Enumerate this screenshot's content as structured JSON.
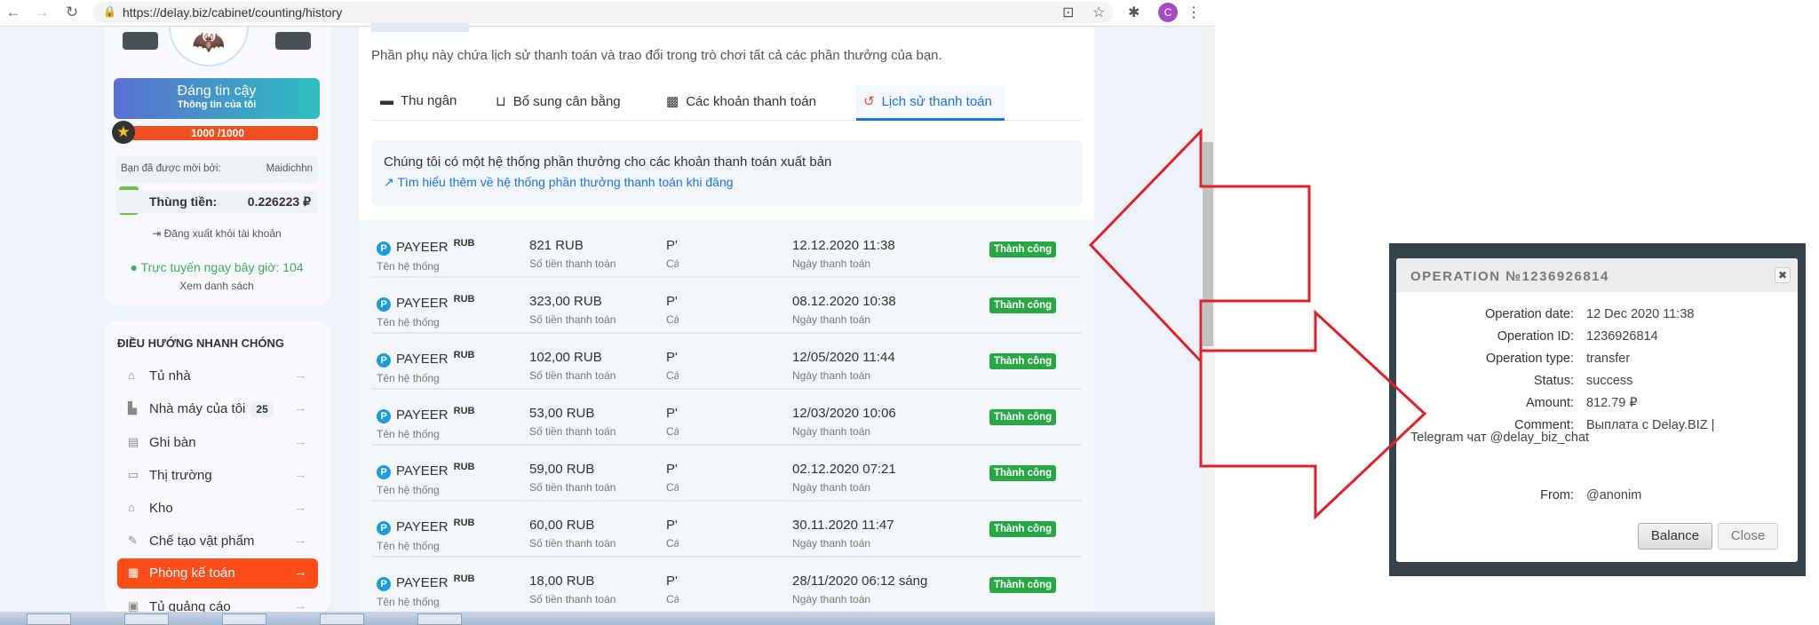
{
  "browser": {
    "url": "https://delay.biz/cabinet/counting/history",
    "profile_initial": "C"
  },
  "sidebar": {
    "trust_title": "Đáng tin cậy",
    "trust_sub": "Thông tin của tôi",
    "xp": "1000 /1000",
    "xp_fraction": 1.0,
    "invited_label": "Bạn đã được mời bởi:",
    "invited_value": "Maidichhn",
    "wallet_label": "Thùng tiền:",
    "wallet_value": "0.226223 ₽",
    "logout": "Đăng xuất khỏi tài khoản",
    "online_label": "Trực tuyến ngay bây giờ:",
    "online_count": "104",
    "view_list": "Xem danh sách",
    "nav_heading": "ĐIỀU HƯỚNG NHANH CHÓNG",
    "nav": [
      {
        "label": "Tủ nhà",
        "icon": "home-icon"
      },
      {
        "label": "Nhà máy của tôi",
        "badge": "25",
        "icon": "factory-icon"
      },
      {
        "label": "Ghi bàn",
        "icon": "score-icon"
      },
      {
        "label": "Thị trường",
        "icon": "market-icon"
      },
      {
        "label": "Kho",
        "icon": "warehouse-icon"
      },
      {
        "label": "Chế tạo vật phẩm",
        "icon": "craft-icon"
      },
      {
        "label": "Phòng kế toán",
        "icon": "accounting-icon",
        "active": true
      },
      {
        "label": "Tủ quảng cáo",
        "icon": "ads-icon"
      }
    ]
  },
  "main": {
    "description": "Phần phụ này chứa lịch sử thanh toán và trao đổi trong trò chơi tất cả các phần thưởng của bạn.",
    "tabs": [
      {
        "label": "Thu ngân",
        "icon": "wallet-icon"
      },
      {
        "label": "Bổ sung cân bằng",
        "icon": "basket-icon"
      },
      {
        "label": "Các khoản thanh toán",
        "icon": "cash-icon"
      },
      {
        "label": "Lịch sử thanh toán",
        "icon": "history-icon",
        "active": true
      }
    ],
    "info_text": "Chúng tôi có một hệ thống phần thưởng cho các khoản thanh toán xuất bản",
    "info_link": "Tìm hiểu thêm về hệ thống phần thưởng thanh toán khi đăng",
    "labels": {
      "system": "Tên hệ thống",
      "amount": "Số tiền thanh toán",
      "col3": "Cá",
      "date": "Ngày thanh toán"
    },
    "rows": [
      {
        "system": "PAYEER",
        "currency": "RUB",
        "amount": "821 RUB",
        "col3": "P'",
        "date": "12.12.2020 11:38",
        "status": "Thành công"
      },
      {
        "system": "PAYEER",
        "currency": "RUB",
        "amount": "323,00 RUB",
        "col3": "P'",
        "date": "08.12.2020 10:38",
        "status": "Thành công"
      },
      {
        "system": "PAYEER",
        "currency": "RUB",
        "amount": "102,00 RUB",
        "col3": "P'",
        "date": "12/05/2020 11:44",
        "status": "Thành công"
      },
      {
        "system": "PAYEER",
        "currency": "RUB",
        "amount": "53,00 RUB",
        "col3": "P'",
        "date": "12/03/2020 10:06",
        "status": "Thành công"
      },
      {
        "system": "PAYEER",
        "currency": "RUB",
        "amount": "59,00 RUB",
        "col3": "P'",
        "date": "02.12.2020 07:21",
        "status": "Thành công"
      },
      {
        "system": "PAYEER",
        "currency": "RUB",
        "amount": "60,00 RUB",
        "col3": "P'",
        "date": "30.11.2020 11:47",
        "status": "Thành công"
      },
      {
        "system": "PAYEER",
        "currency": "RUB",
        "amount": "18,00 RUB",
        "col3": "P'",
        "date": "28/11/2020 06:12 sáng",
        "status": "Thành công"
      }
    ]
  },
  "modal": {
    "title": "OPERATION №1236926814",
    "fields": [
      {
        "k": "Operation date:",
        "v": "12 Dec 2020 11:38"
      },
      {
        "k": "Operation ID:",
        "v": "1236926814"
      },
      {
        "k": "Operation type:",
        "v": "transfer"
      },
      {
        "k": "Status:",
        "v": "success"
      },
      {
        "k": "Amount:",
        "v": "812.79 ₽"
      },
      {
        "k": "Comment:",
        "v": "Выплата с Delay.BIZ |"
      }
    ],
    "comment_cont": "Telegram чат @delay_biz_chat",
    "from_label": "From:",
    "from_value": "@anonim",
    "balance_btn": "Balance",
    "close_btn": "Close"
  },
  "colors": {
    "accent": "#1a73e8",
    "active_nav": "#ff4d1a",
    "success": "#28a745",
    "annotation": "#e0202a"
  }
}
